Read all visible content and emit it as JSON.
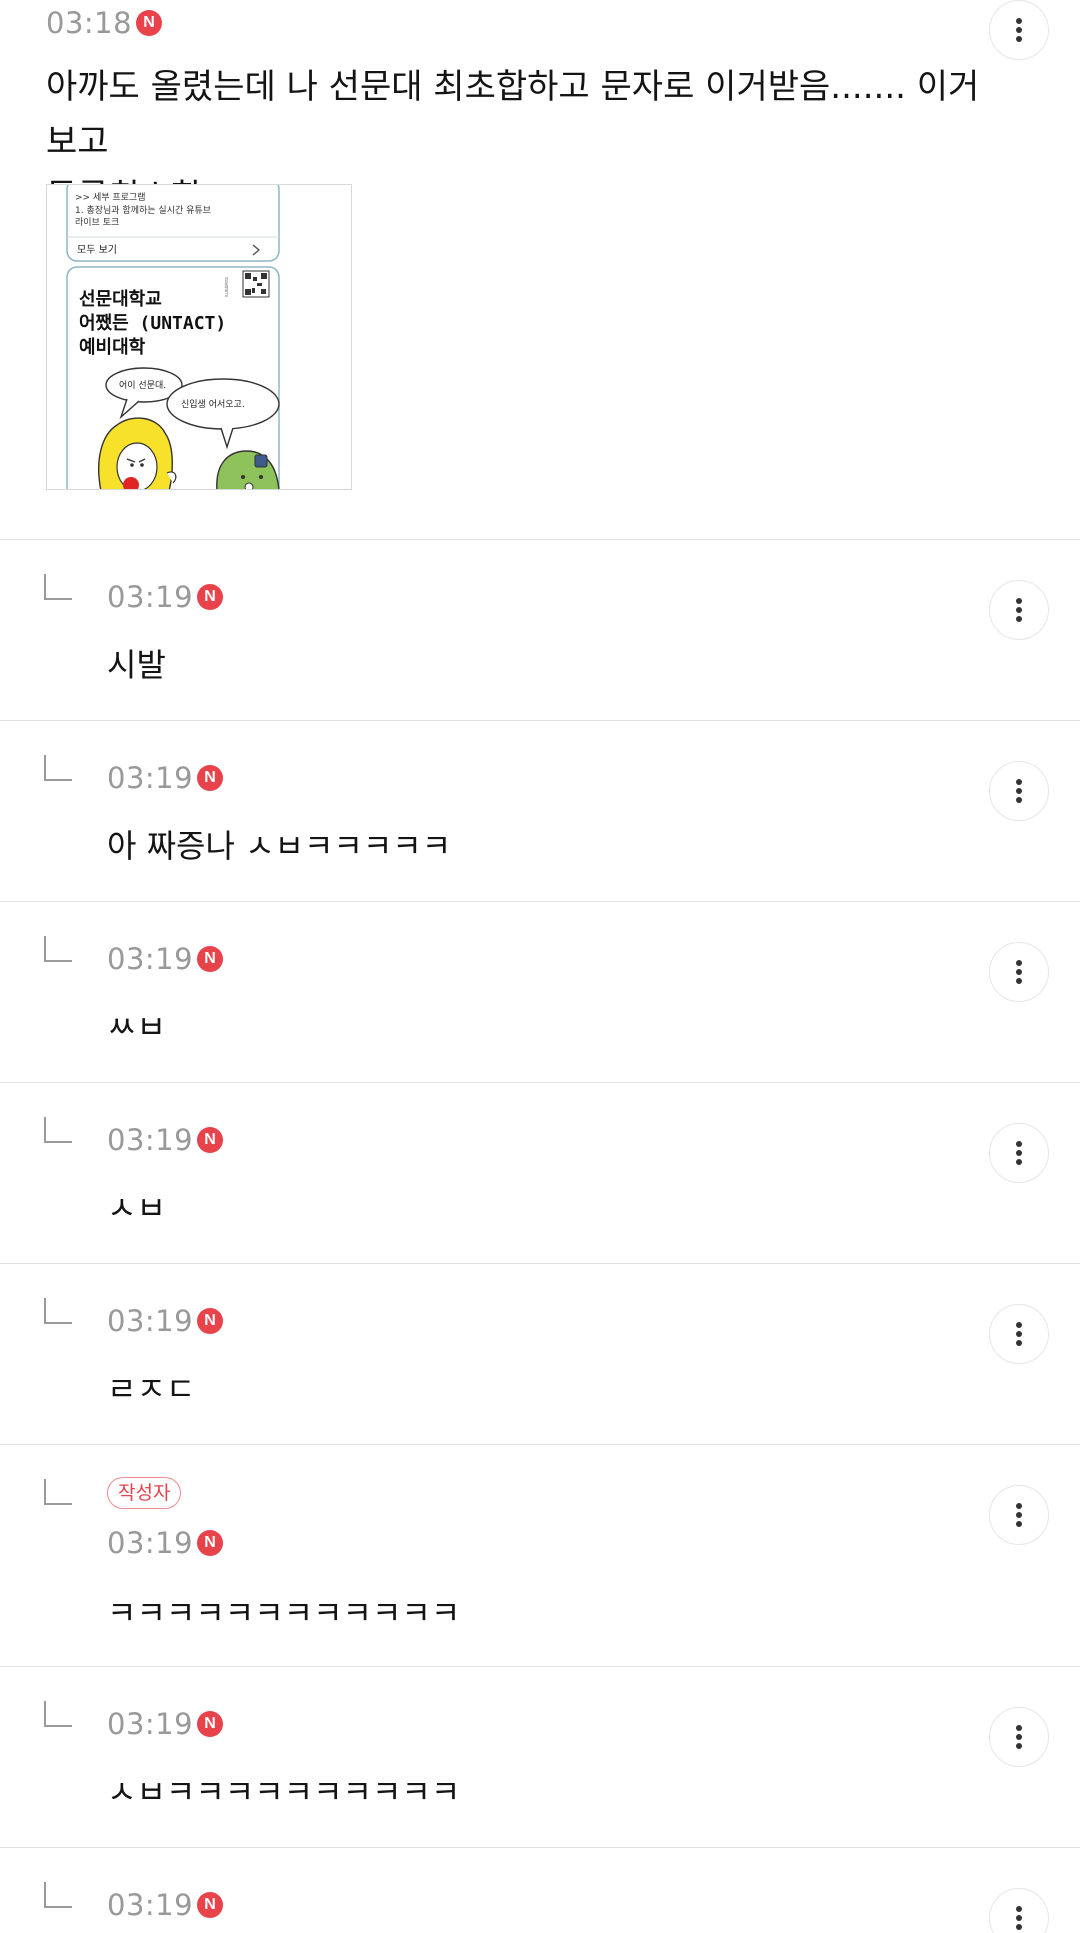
{
  "post": {
    "time": "03:18",
    "new_badge": "N",
    "text_line1": "아까도 올렸는데 나 선문대 최초합하고 문자로 이거받음....... 이거보고",
    "text_line2": "등록취소함",
    "image": {
      "header_lines": [
        ">> 세부 프로그램",
        "1. 총장님과 함께하는 실시간 유튜브",
        "라이브 토크"
      ],
      "see_all": "모두 보기",
      "title_lines": [
        "선문대학교",
        "어쨌든 (UNTACT)",
        "예비대학"
      ],
      "bubble_left": "어이 선문대.",
      "bubble_right": "신입생 어서오고.",
      "stamp": "선문대학교"
    }
  },
  "replies": [
    {
      "time": "03:19",
      "new_badge": "N",
      "text": "시발"
    },
    {
      "time": "03:19",
      "new_badge": "N",
      "text": "아 짜증나 ㅅㅂㅋㅋㅋㅋㅋ"
    },
    {
      "time": "03:19",
      "new_badge": "N",
      "text": "ㅆㅂ"
    },
    {
      "time": "03:19",
      "new_badge": "N",
      "text": "ㅅㅂ"
    },
    {
      "time": "03:19",
      "new_badge": "N",
      "text": "ㄹㅈㄷ"
    },
    {
      "time": "03:19",
      "new_badge": "N",
      "text": "ㅋㅋㅋㅋㅋㅋㅋㅋㅋㅋㅋㅋ",
      "author_tag": "작성자"
    },
    {
      "time": "03:19",
      "new_badge": "N",
      "text": "ㅅㅂㅋㅋㅋㅋㅋㅋㅋㅋㅋㅋ"
    },
    {
      "time": "03:19",
      "new_badge": "N",
      "text": ""
    }
  ],
  "icons": {
    "more": "more-vertical-icon",
    "reply": "reply-arrow-icon"
  },
  "colors": {
    "badge": "#e8424b",
    "time": "#999999",
    "divider": "#e2e2e2"
  }
}
